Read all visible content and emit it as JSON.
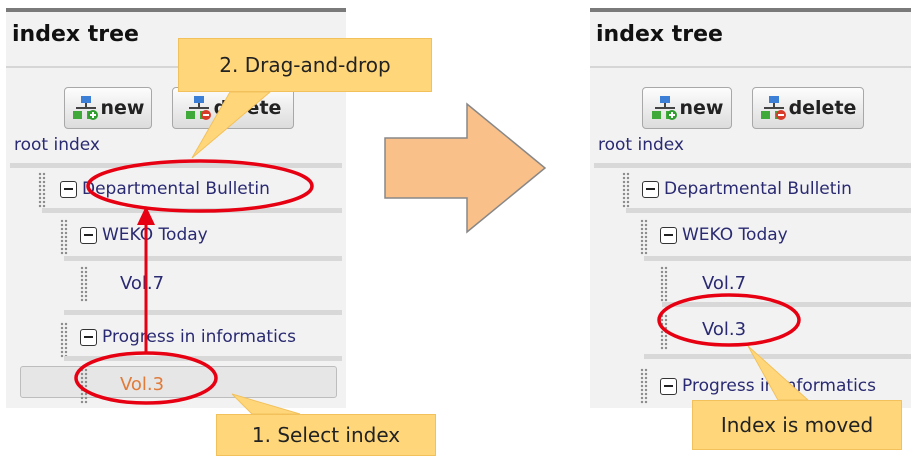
{
  "left": {
    "title": "index tree",
    "new_label": "new",
    "delete_label": "delete",
    "root_link": "root index",
    "nodes": {
      "departmental": "Departmental Bulletin",
      "weko": "WEKO Today",
      "vol7": "Vol.7",
      "progress": "Progress in informatics",
      "vol3": "Vol.3"
    }
  },
  "right": {
    "title": "index tree",
    "new_label": "new",
    "delete_label": "delete",
    "root_link": "root index",
    "nodes": {
      "departmental": "Departmental Bulletin",
      "weko": "WEKO Today",
      "vol7": "Vol.7",
      "vol3": "Vol.3",
      "progress": "Progress in informatics"
    }
  },
  "callouts": {
    "drag": "2. Drag-and-drop",
    "select": "1. Select index",
    "moved": "Index is moved"
  },
  "colors": {
    "link": "#2a2a72",
    "selected": "#e07b39",
    "callout": "#ffd77a",
    "arrow": "#f9c08a",
    "annotation": "#e60012"
  },
  "icons": {
    "new": "tree-add-icon",
    "delete": "tree-delete-icon",
    "toggle": "collapse-minus-icon",
    "grip": "drag-handle-icon",
    "arrow": "right-arrow-icon"
  }
}
